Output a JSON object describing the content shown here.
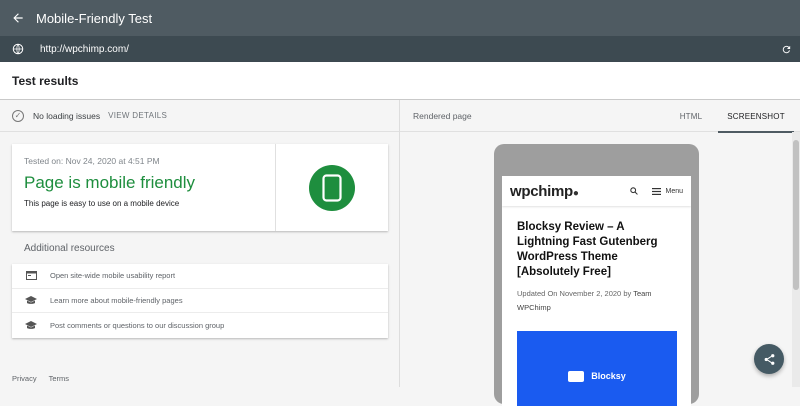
{
  "appbar": {
    "title": "Mobile-Friendly Test"
  },
  "urlbar": {
    "url": "http://wpchimp.com/"
  },
  "results": {
    "title": "Test results"
  },
  "left": {
    "status_text": "No loading issues",
    "view_details": "VIEW DETAILS",
    "card": {
      "tested_on": "Tested on: Nov 24, 2020 at 4:51 PM",
      "headline": "Page is mobile friendly",
      "subtext": "This page is easy to use on a mobile device",
      "accent": "#1e8e3e"
    },
    "additional_title": "Additional resources",
    "resources": [
      {
        "label": "Open site-wide mobile usability report",
        "icon": "report-icon"
      },
      {
        "label": "Learn more about mobile-friendly pages",
        "icon": "graduation-cap-icon"
      },
      {
        "label": "Post comments or questions to our discussion group",
        "icon": "graduation-cap-icon"
      }
    ],
    "footer": {
      "privacy": "Privacy",
      "terms": "Terms"
    }
  },
  "right": {
    "rendered_label": "Rendered page",
    "tabs": [
      {
        "label": "HTML",
        "active": false
      },
      {
        "label": "SCREENSHOT",
        "active": true
      }
    ],
    "preview": {
      "logo": "wpchimp",
      "menu_label": "Menu",
      "article_title": "Blocksy Review – A Lightning Fast Gutenberg WordPress Theme [Absolutely Free]",
      "meta_prefix": "Updated On November 2, 2020 by",
      "author": "Team WPChimp",
      "hero_label": "Blocksy",
      "hero_color": "#1a5bf0"
    }
  }
}
